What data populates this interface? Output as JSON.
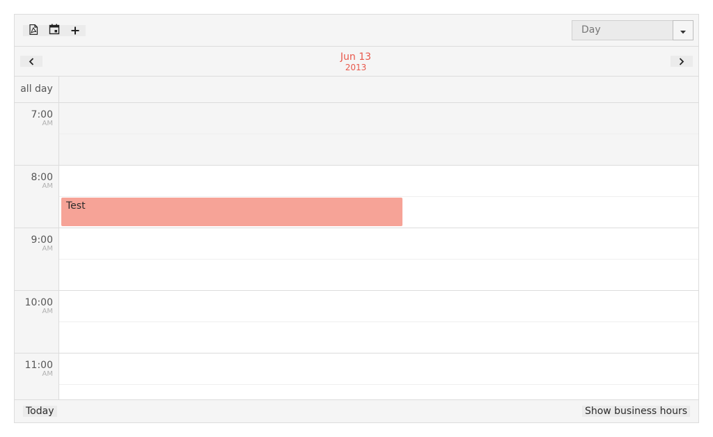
{
  "toolbar": {
    "icons": [
      "pdf-icon",
      "calendar-icon",
      "plus-icon"
    ],
    "view_select": {
      "value": "Day"
    }
  },
  "header": {
    "date_main": "Jun 13",
    "date_year": "2013",
    "accent_color": "#e8574a"
  },
  "allday": {
    "label": "all day"
  },
  "times": [
    {
      "hour": "7:00",
      "ampm": "AM"
    },
    {
      "hour": "8:00",
      "ampm": "AM"
    },
    {
      "hour": "9:00",
      "ampm": "AM"
    },
    {
      "hour": "10:00",
      "ampm": "AM"
    },
    {
      "hour": "11:00",
      "ampm": "AM"
    }
  ],
  "event": {
    "title": "Test",
    "color": "#f6a397"
  },
  "footer": {
    "today_label": "Today",
    "business_hours_label": "Show business hours"
  }
}
